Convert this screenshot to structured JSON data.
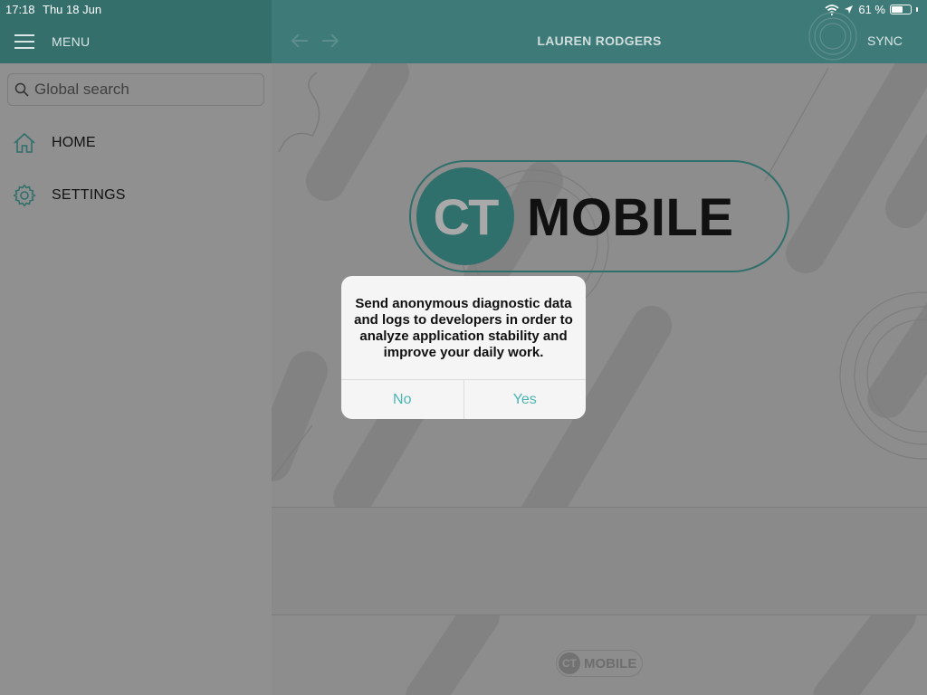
{
  "status_bar": {
    "time": "17:18",
    "date": "Thu 18 Jun",
    "battery": "61 %",
    "battery_level": 0.61
  },
  "header": {
    "menu_label": "MENU",
    "title": "LAUREN RODGERS",
    "sync_label": "SYNC",
    "icons": [
      "hamburger-icon",
      "back-arrow-icon",
      "forward-arrow-icon",
      "sync-icon"
    ]
  },
  "sidebar": {
    "search_placeholder": "Global search",
    "items": [
      {
        "label": "HOME",
        "icon": "home-icon"
      },
      {
        "label": "SETTINGS",
        "icon": "gear-icon"
      }
    ]
  },
  "main": {
    "logo_ct": "CT",
    "logo_word": "MOBILE",
    "footer_logo_ct": "CT",
    "footer_logo_word": "MOBILE"
  },
  "dialog": {
    "message": "Send anonymous diagnostic data and logs to developers in order to analyze application stability and improve your daily work.",
    "no_label": "No",
    "yes_label": "Yes"
  },
  "colors": {
    "header_teal": "#3d7a78",
    "accent_teal": "#2f6f6c",
    "button_text": "#4bb6b3",
    "overlay_gray": "#8d8d8d"
  }
}
